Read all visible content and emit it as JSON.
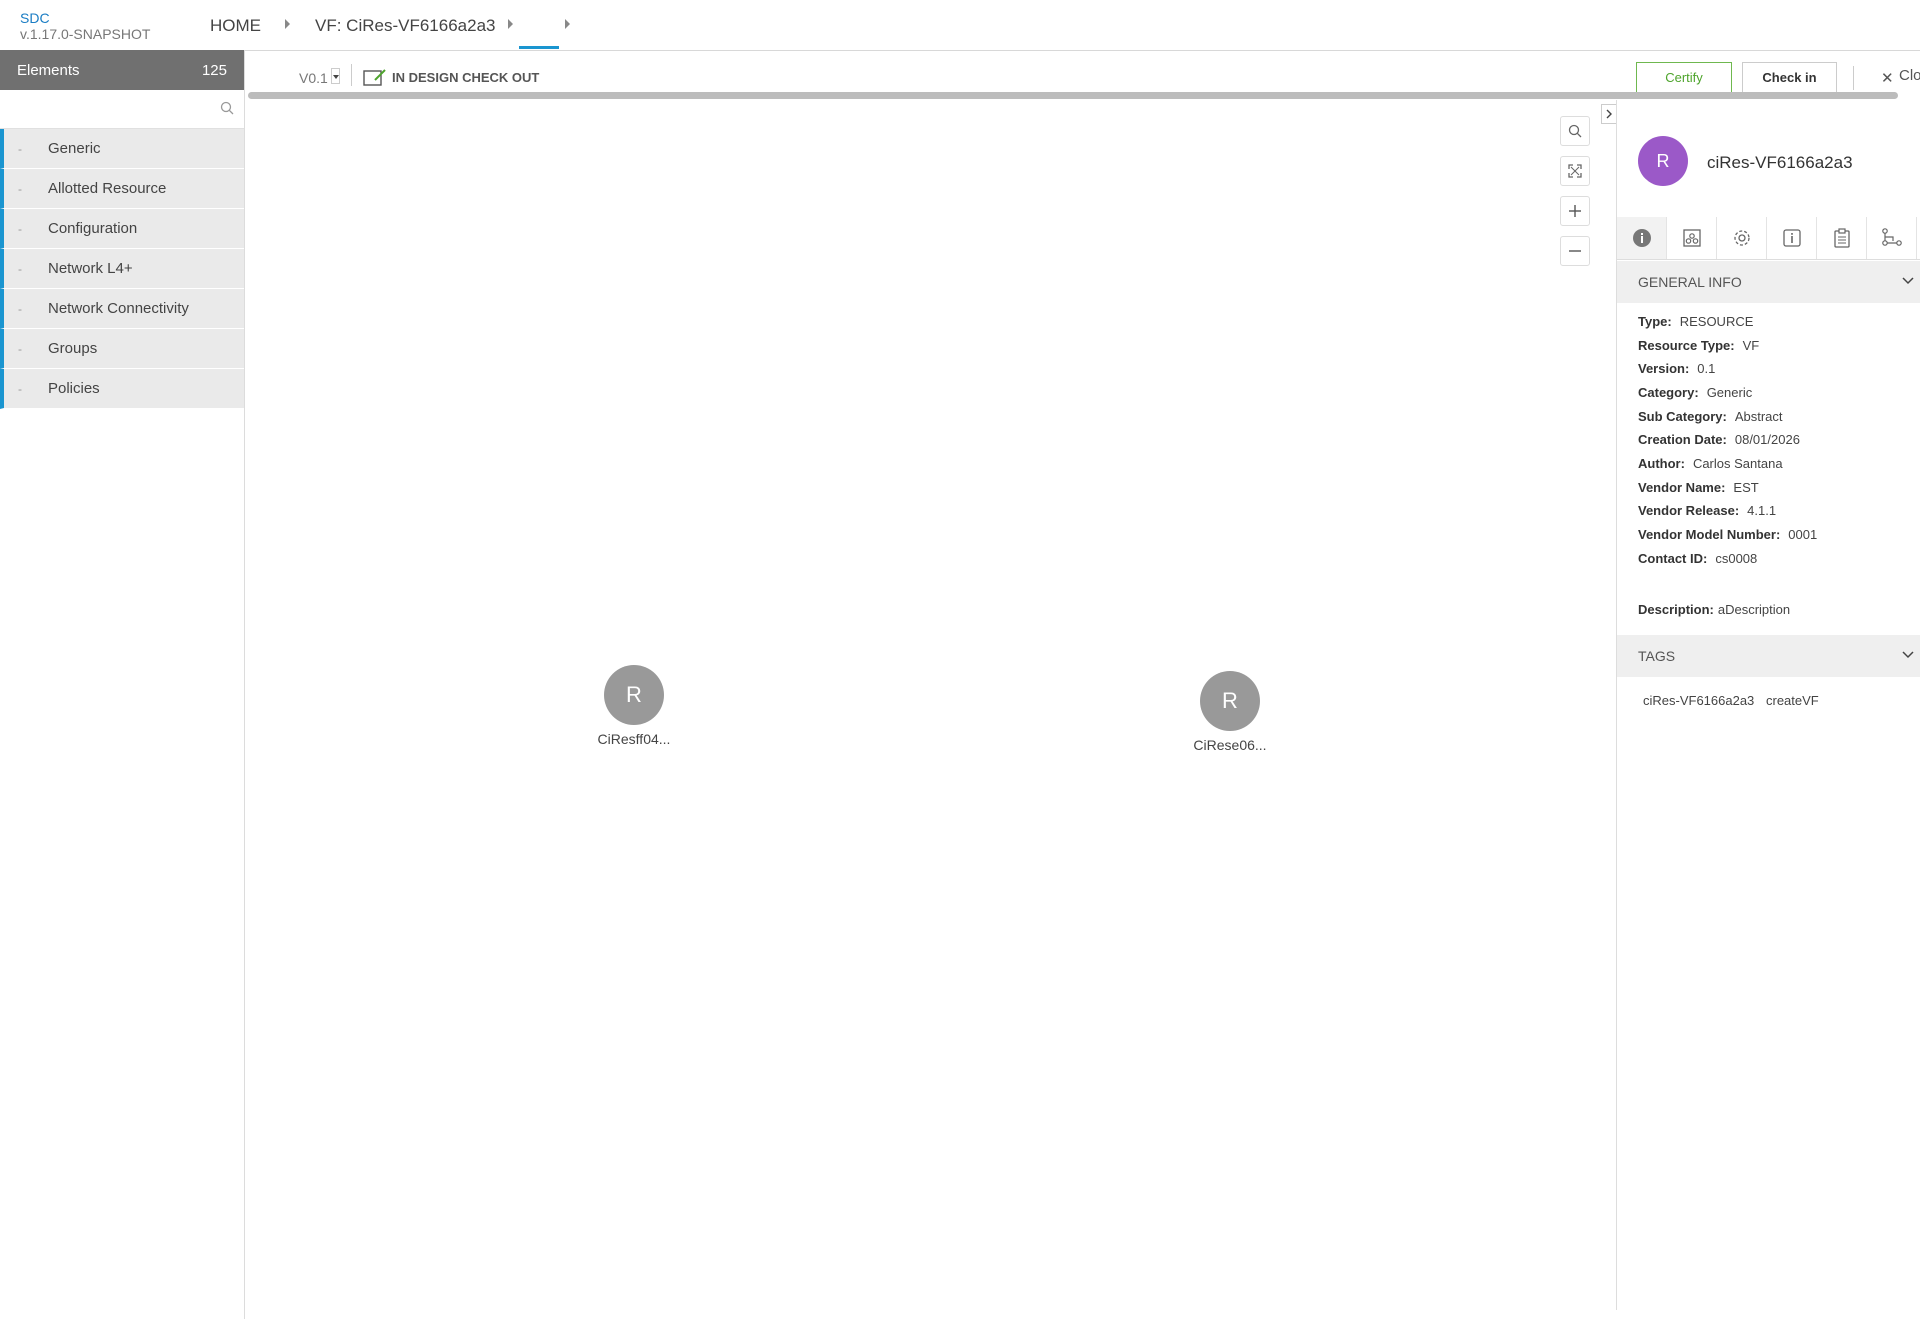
{
  "header": {
    "brand_name": "SDC",
    "brand_version": "v.1.17.0-SNAPSHOT",
    "breadcrumbs": [
      "HOME",
      "VF: CiRes-VF6166a2a3"
    ]
  },
  "palette": {
    "title": "Elements",
    "count": "125",
    "search_placeholder": "",
    "categories": [
      {
        "dash": "-",
        "label": "Generic"
      },
      {
        "dash": "-",
        "label": "Allotted Resource"
      },
      {
        "dash": "-",
        "label": "Configuration"
      },
      {
        "dash": "-",
        "label": "Network L4+"
      },
      {
        "dash": "-",
        "label": "Network Connectivity"
      },
      {
        "dash": "-",
        "label": "Groups"
      },
      {
        "dash": "-",
        "label": "Policies"
      }
    ]
  },
  "toolbar": {
    "version": "V0.1",
    "status": "IN DESIGN CHECK OUT",
    "certify_label": "Certify",
    "checkin_label": "Check in",
    "close_label": "Clo"
  },
  "canvas": {
    "nodes": [
      {
        "letter": "R",
        "name": "CiResff04..."
      },
      {
        "letter": "R",
        "name": "CiRese06..."
      }
    ]
  },
  "details": {
    "avatar_letter": "R",
    "title": "ciRes-VF6166a2a3",
    "tabs": [
      "info-icon",
      "composition-icon",
      "properties-icon",
      "information-icon",
      "requirements-icon",
      "relations-icon"
    ],
    "general_info_label": "GENERAL INFO",
    "fields": [
      {
        "key": "Type:",
        "value": "RESOURCE"
      },
      {
        "key": "Resource Type:",
        "value": "VF"
      },
      {
        "key": "Version:",
        "value": "0.1"
      },
      {
        "key": "Category:",
        "value": "Generic"
      },
      {
        "key": "Sub Category:",
        "value": "Abstract"
      },
      {
        "key": "Creation Date:",
        "value": "08/01/2026"
      },
      {
        "key": "Author:",
        "value": "Carlos Santana"
      },
      {
        "key": "Vendor Name:",
        "value": "EST"
      },
      {
        "key": "Vendor Release:",
        "value": "4.1.1"
      },
      {
        "key": "Vendor Model Number:",
        "value": "0001"
      },
      {
        "key": "Contact ID:",
        "value": "cs0008"
      }
    ],
    "description_key": "Description:",
    "description_value": "aDescription",
    "tags_label": "TAGS",
    "tags": [
      "ciRes-VF6166a2a3",
      "createVF"
    ]
  },
  "colors": {
    "accent": "#1a95d0",
    "certify_green": "#4ea42c",
    "avatar_purple": "#9b59c8",
    "node_gray": "#999999"
  }
}
